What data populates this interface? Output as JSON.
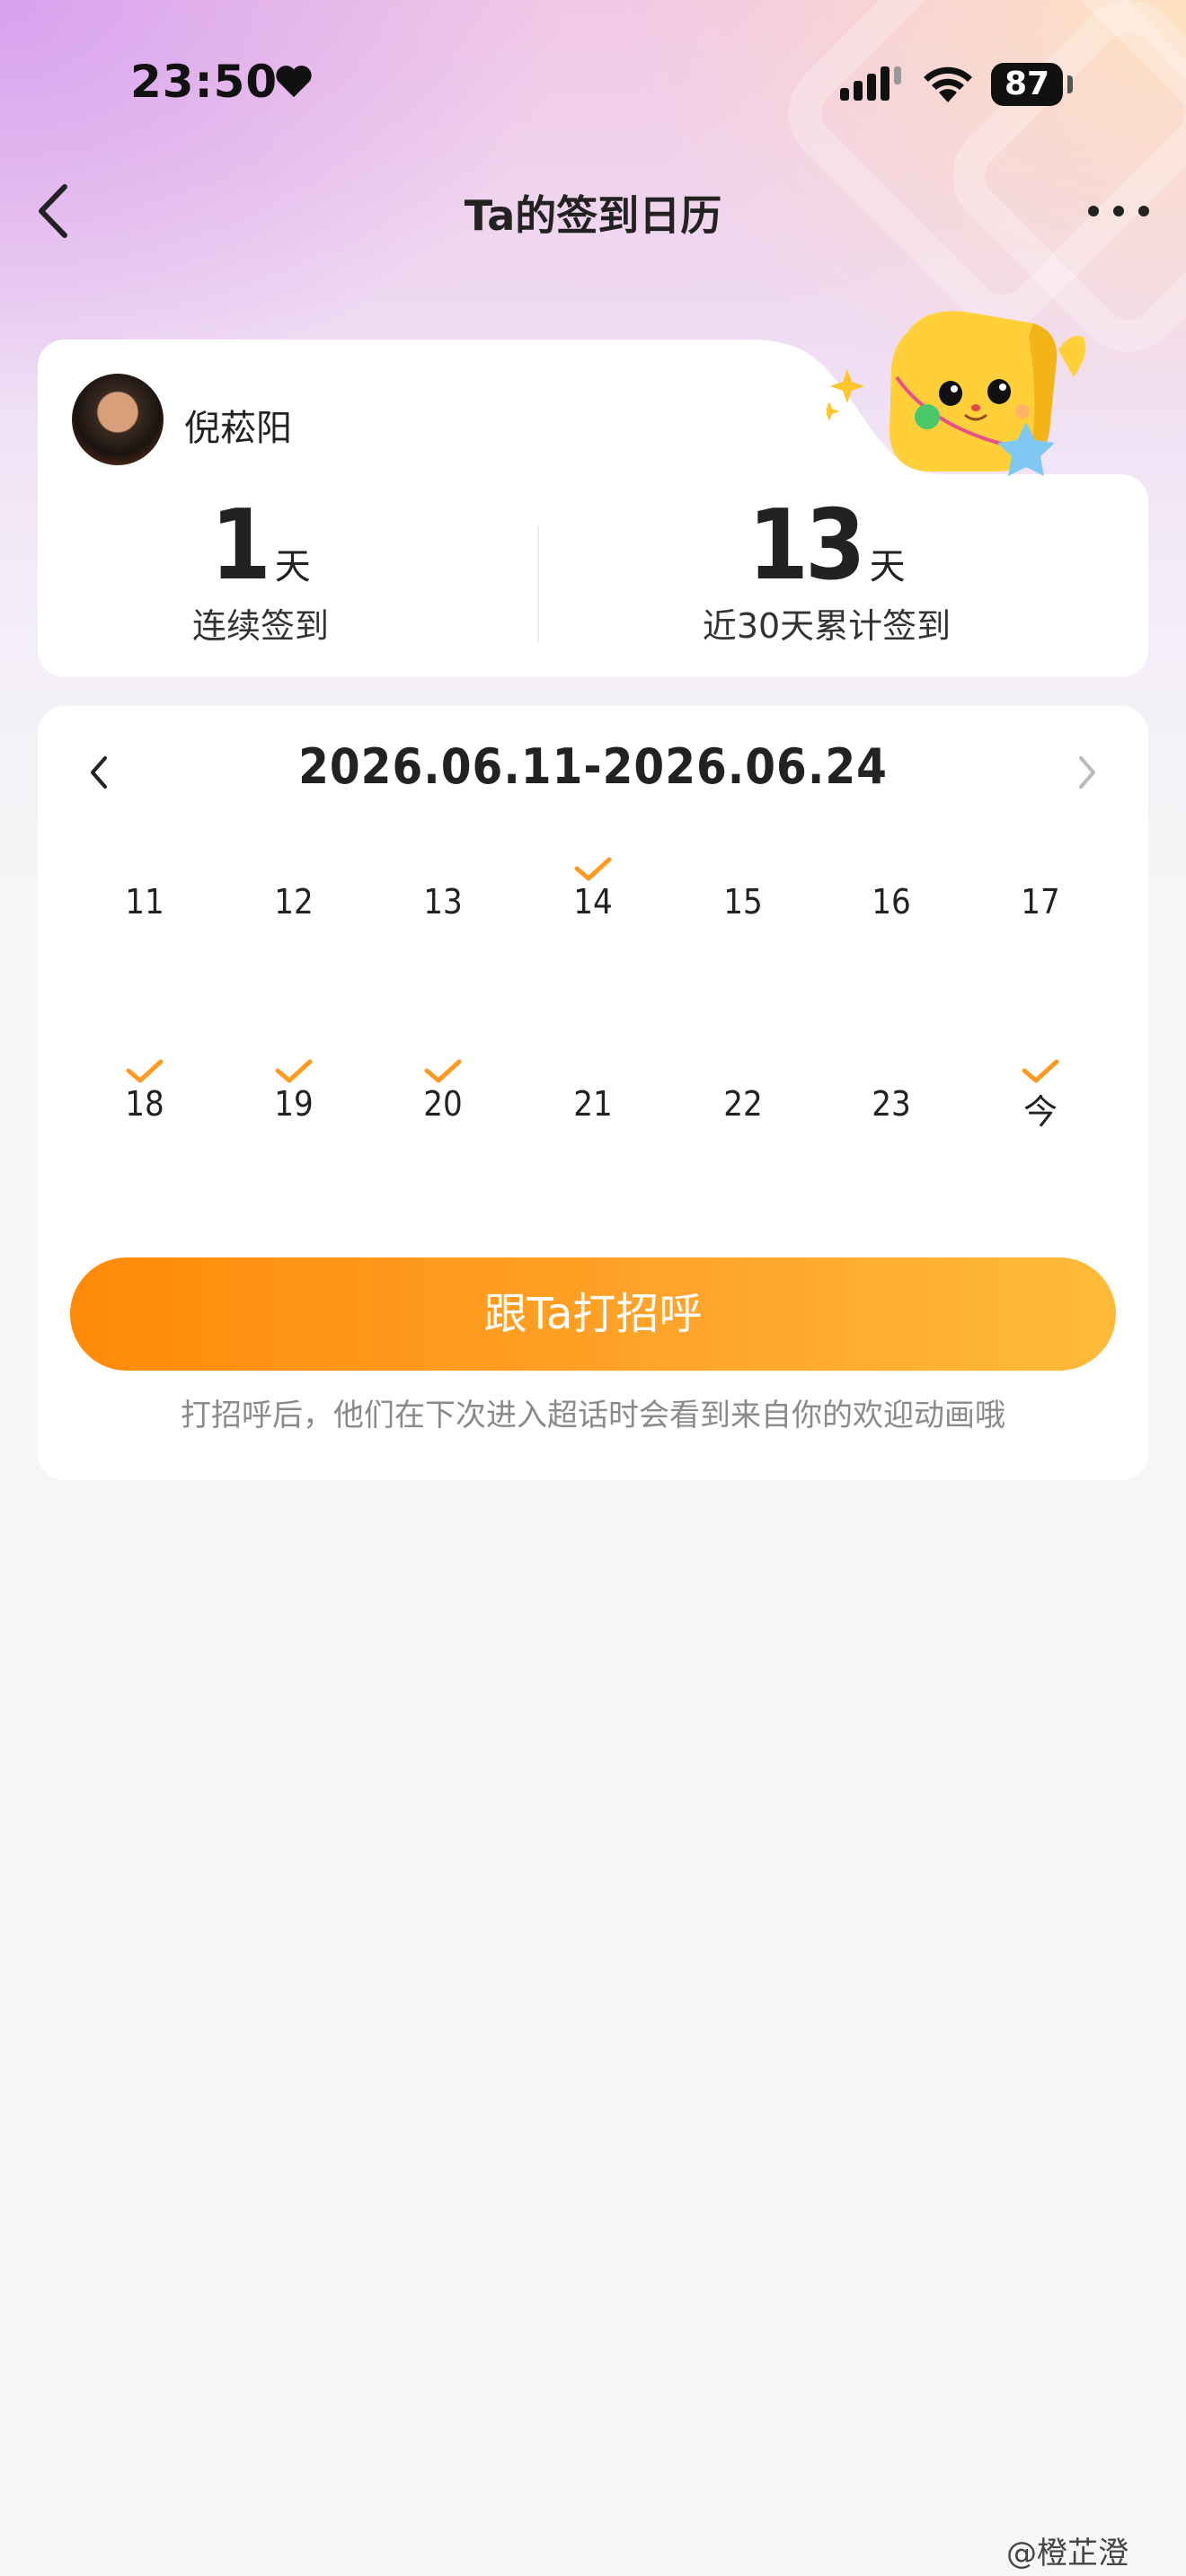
{
  "status_bar": {
    "time": "23:50",
    "battery": "87"
  },
  "nav": {
    "title": "Ta的签到日历"
  },
  "profile": {
    "name": "倪菘阳"
  },
  "stats": [
    {
      "value": "1",
      "unit": "天",
      "label": "连续签到"
    },
    {
      "value": "13",
      "unit": "天",
      "label": "近30天累计签到"
    }
  ],
  "calendar": {
    "range": "2026.06.11-2026.06.24",
    "days": [
      {
        "label": "11",
        "checked": false
      },
      {
        "label": "12",
        "checked": false
      },
      {
        "label": "13",
        "checked": false
      },
      {
        "label": "14",
        "checked": true
      },
      {
        "label": "15",
        "checked": false
      },
      {
        "label": "16",
        "checked": false
      },
      {
        "label": "17",
        "checked": false
      },
      {
        "label": "18",
        "checked": true
      },
      {
        "label": "19",
        "checked": true
      },
      {
        "label": "20",
        "checked": true
      },
      {
        "label": "21",
        "checked": false
      },
      {
        "label": "22",
        "checked": false
      },
      {
        "label": "23",
        "checked": false
      },
      {
        "label": "今",
        "checked": true
      }
    ]
  },
  "greet_button": {
    "label": "跟Ta打招呼"
  },
  "hint": "打招呼后，他们在下次进入超话时会看到来自你的欢迎动画哦",
  "watermark": "@橙芷澄",
  "colors": {
    "accent": "#ff9a1f",
    "check": "#ff9a1f"
  },
  "icons": {
    "back": "chevron-left-icon",
    "more": "more-dots-icon",
    "check": "check-icon"
  }
}
